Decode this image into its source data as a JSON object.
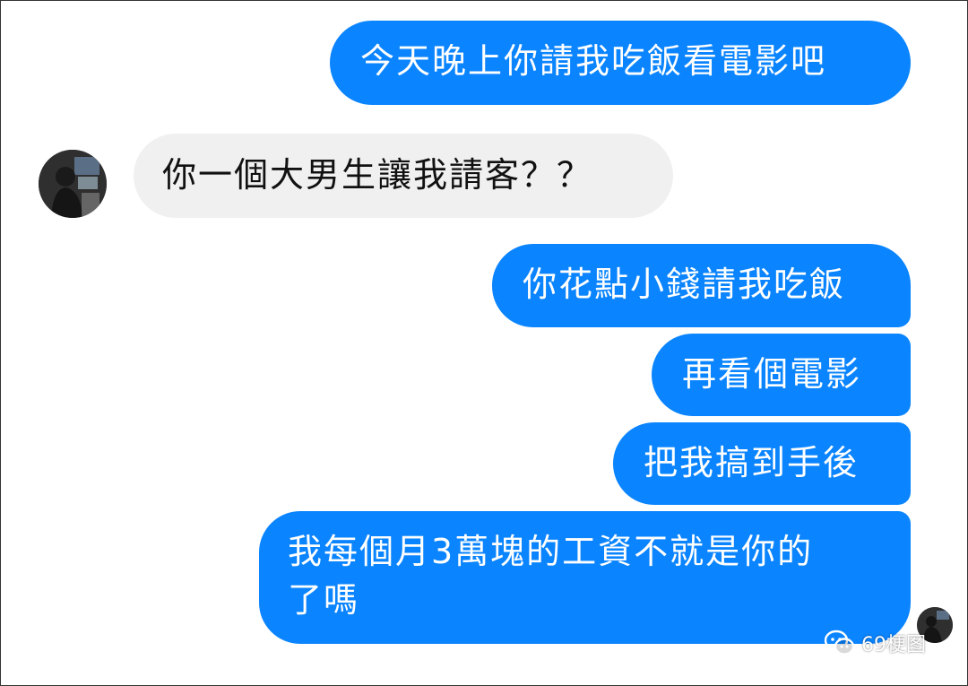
{
  "chat": {
    "messages": [
      {
        "sender": "me",
        "text": "今天晚上你請我吃飯看電影吧"
      },
      {
        "sender": "other",
        "text": "你一個大男生讓我請客？？"
      },
      {
        "sender": "me",
        "text": "你花點小錢請我吃飯"
      },
      {
        "sender": "me",
        "text": "再看個電影"
      },
      {
        "sender": "me",
        "text": "把我搞到手後"
      },
      {
        "sender": "me",
        "text_line1": "我每個月3萬塊的工資不就是你的",
        "text_line2": "了嗎"
      }
    ]
  },
  "watermark": {
    "text": "69梗图",
    "icon": "wechat-icon"
  },
  "colors": {
    "outgoing_bubble": "#0a84ff",
    "incoming_bubble": "#f0f0f0",
    "outgoing_text": "#ffffff",
    "incoming_text": "#111111"
  }
}
